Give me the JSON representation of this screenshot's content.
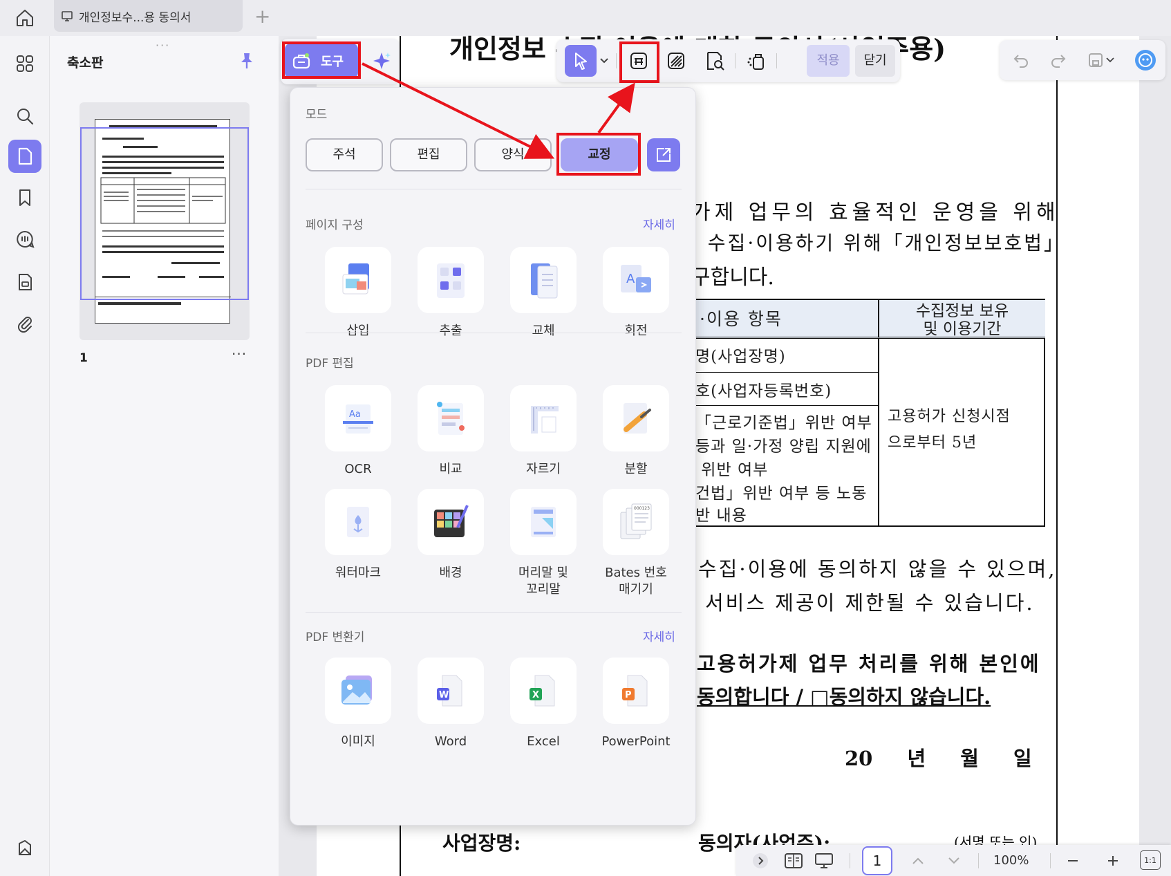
{
  "titlebar": {
    "tab_title": "개인정보수...용 동의서",
    "new_tab": "+"
  },
  "thumbnail_panel": {
    "title": "축소판",
    "page_number": "1",
    "more": "···"
  },
  "tools": {
    "label": "도구"
  },
  "markup_toolbar": {
    "apply": "적용",
    "close": "닫기"
  },
  "dropdown": {
    "mode_label": "모드",
    "modes": [
      "주석",
      "편집",
      "양식",
      "교정"
    ],
    "active_mode": "교정",
    "page_section": {
      "title": "페이지 구성",
      "more": "자세히",
      "items": [
        "삽입",
        "추출",
        "교체",
        "회전"
      ]
    },
    "edit_section": {
      "title": "PDF 편집",
      "items": [
        "OCR",
        "비교",
        "자르기",
        "분할",
        "워터마크",
        "배경",
        "머리말 및\n꼬리말",
        "Bates 번호\n매기기"
      ]
    },
    "convert_section": {
      "title": "PDF 변환기",
      "more": "자세히",
      "items": [
        "이미지",
        "Word",
        "Excel",
        "PowerPoint"
      ]
    }
  },
  "document": {
    "title": "개인정보 수집·이용에 대한 동의서(사업주용)",
    "p1": "가제 업무의 효율적인 운영을 위해",
    "p2": "· 수집·이용하기 위해「개인정보보호법」",
    "p3": "구합니다.",
    "table_head_left": "·이용 항목",
    "table_head_right": "수집정보 보유\n및 이용기간",
    "table_rows": [
      "명(사업장명)",
      "호(사업자등록번호)",
      "「근로기준법」위반 여부",
      "등과 일·가정 양립 지원에",
      " 위반 여부",
      "건법」위반 여부 등 노동",
      "반 내용"
    ],
    "retention": "고용허가  신청시점\n으로부터 5년",
    "p4": "수집·이용에 동의하지 않을 수 있으며,",
    "p5": "서비스 제공이 제한될 수 있습니다.",
    "p6": "고용허가제 업무 처리를 위해 본인에",
    "p7": "동의합니다 / □동의하지 않습니다.",
    "date": "20 년 월 일",
    "sign1": "사업장명:",
    "sign2": "동의자(사업주):",
    "sign3": "(서명 또는 인)"
  },
  "status_bar": {
    "page": "1",
    "zoom": "100%",
    "fit": "1:1"
  },
  "colors": {
    "accent": "#7d7bef",
    "highlight": "#e8141c"
  }
}
